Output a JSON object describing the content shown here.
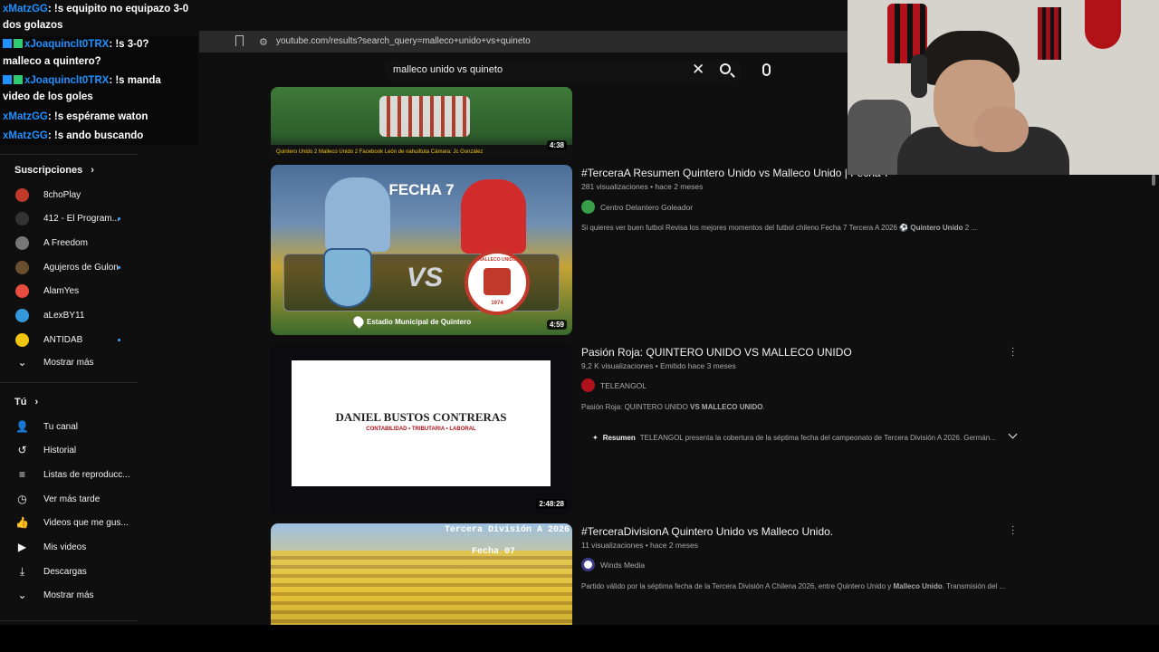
{
  "browser": {
    "url": "youtube.com/results?search_query=malleco+unido+vs+quineto"
  },
  "search": {
    "query": "malleco unido vs quineto"
  },
  "sidebar": {
    "subs_heading": "Suscripciones",
    "subs": [
      {
        "label": "8choPlay",
        "color": "#c0392b",
        "dot": false
      },
      {
        "label": "412 - El Program...",
        "color": "#333333",
        "dot": true
      },
      {
        "label": "A Freedom",
        "color": "#777777",
        "dot": false
      },
      {
        "label": "Agujeros de Gulon",
        "color": "#6b4e2e",
        "dot": true
      },
      {
        "label": "AlamYes",
        "color": "#e74c3c",
        "dot": false
      },
      {
        "label": "aLexBY11",
        "color": "#3498db",
        "dot": false
      },
      {
        "label": "ANTIDAB",
        "color": "#f1c40f",
        "dot": true
      }
    ],
    "subs_more": "Mostrar más",
    "you_heading": "Tú",
    "you": [
      {
        "label": "Tu canal",
        "icon": "channel-icon"
      },
      {
        "label": "Historial",
        "icon": "history-icon"
      },
      {
        "label": "Listas de reproducc...",
        "icon": "playlists-icon"
      },
      {
        "label": "Ver más tarde",
        "icon": "watch-later-icon"
      },
      {
        "label": "Videos que me gus...",
        "icon": "like-icon"
      },
      {
        "label": "Mis videos",
        "icon": "my-videos-icon"
      },
      {
        "label": "Descargas",
        "icon": "download-icon"
      }
    ],
    "you_more": "Mostrar más"
  },
  "chat": [
    {
      "user": "xMatzGG",
      "text": ": !s equipito no equipazo 3-0"
    },
    {
      "user": "",
      "text": "dos golazos"
    },
    {
      "user": "xJoaquinclt0TRX",
      "text": ": !s 3-0?"
    },
    {
      "user": "",
      "text": "malleco a quintero?"
    },
    {
      "user": "xJoaquinclt0TRX",
      "text": ": !s manda"
    },
    {
      "user": "",
      "text": "video de los goles"
    },
    {
      "user": "xMatzGG",
      "text": ": !s espérame waton"
    },
    {
      "user": "xMatzGG",
      "text": ": !s ando buscando"
    }
  ],
  "videos": [
    {
      "thumb_caption": "Quintero Unido 2 Malleco Unido 2   Facebook León de nahuiltuta   Cámara: Jc González",
      "duration": "4:38"
    },
    {
      "title": "#TerceraA Resumen Quintero Unido vs Malleco Unido | Fecha 7",
      "meta": "281 visualizaciones • hace 2 meses",
      "channel": "Centro Delantero Goleador",
      "desc_pre": "Si quieres ver buen futbol Revisa los mejores momentos del futbol chileno Fecha 7 Tercera A 2026 ⚽ ",
      "desc_bold": "Quintero Unido",
      "desc_post": " 2 ...",
      "duration": "4:59",
      "thumb_heading": "FECHA 7",
      "thumb_vs": "VS",
      "thumb_venue": "Estadio Municipal de Quintero",
      "thumb_crest": "MALLECO UNIDO",
      "thumb_year": "1974"
    },
    {
      "title": "Pasión Roja: QUINTERO UNIDO VS MALLECO UNIDO",
      "meta": "9,2 K visualizaciones • Emitido hace 3 meses",
      "channel": "TELEANGOL",
      "desc_pre": "Pasión Roja: QUINTERO UNIDO ",
      "desc_bold": "VS MALLECO UNIDO",
      "desc_post": ".",
      "resumen_label": "Resumen",
      "resumen_text": "TELEANGOL presenta la cobertura de la séptima fecha del campeonato de Tercera División A 2026. Germán...",
      "duration": "2:48:28",
      "thumb_name": "DANIEL BUSTOS CONTRERAS",
      "thumb_sub": "CONTABILIDAD • TRIBUTARIA • LABORAL"
    },
    {
      "title": "#TerceraDivisionA Quintero Unido vs Malleco Unido.",
      "meta": "11 visualizaciones • hace 2 meses",
      "channel": "Winds Media",
      "desc_pre": "Partido válido por la séptima fecha de la Tercera División A Chilena 2026, entre Quintero Unido y ",
      "desc_bold": "Malleco Unido",
      "desc_post": ". Transmisión del ...",
      "thumb_line1": "Tercera División A 2026",
      "thumb_line2": "Fecha 07"
    }
  ]
}
